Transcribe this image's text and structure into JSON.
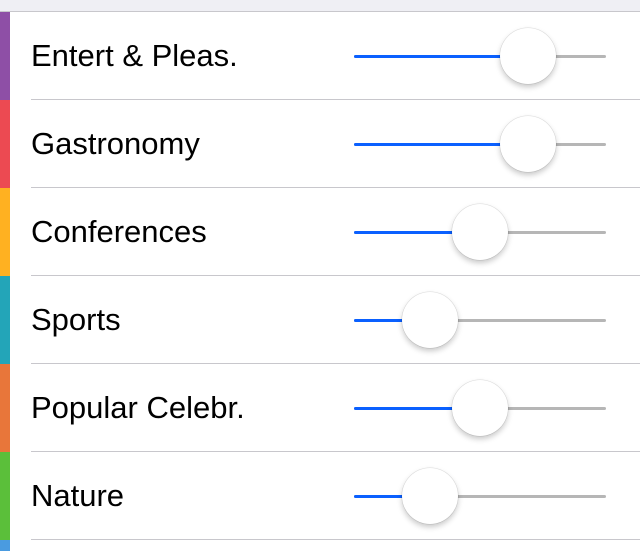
{
  "categories": [
    {
      "label": "Entert & Pleas.",
      "color": "#8e4fa6",
      "level": 0.69
    },
    {
      "label": "Gastronomy",
      "color": "#ec4a52",
      "level": 0.69
    },
    {
      "label": "Conferences",
      "color": "#ffb121",
      "level": 0.5
    },
    {
      "label": "Sports",
      "color": "#23a5b8",
      "level": 0.3
    },
    {
      "label": "Popular Celebr.",
      "color": "#e8763a",
      "level": 0.5
    },
    {
      "label": "Nature",
      "color": "#5bbf3a",
      "level": 0.3
    }
  ],
  "next_row_color": "#4a9be0",
  "slider_colors": {
    "fill": "#0a60ff",
    "track": "#b6b6b6"
  }
}
